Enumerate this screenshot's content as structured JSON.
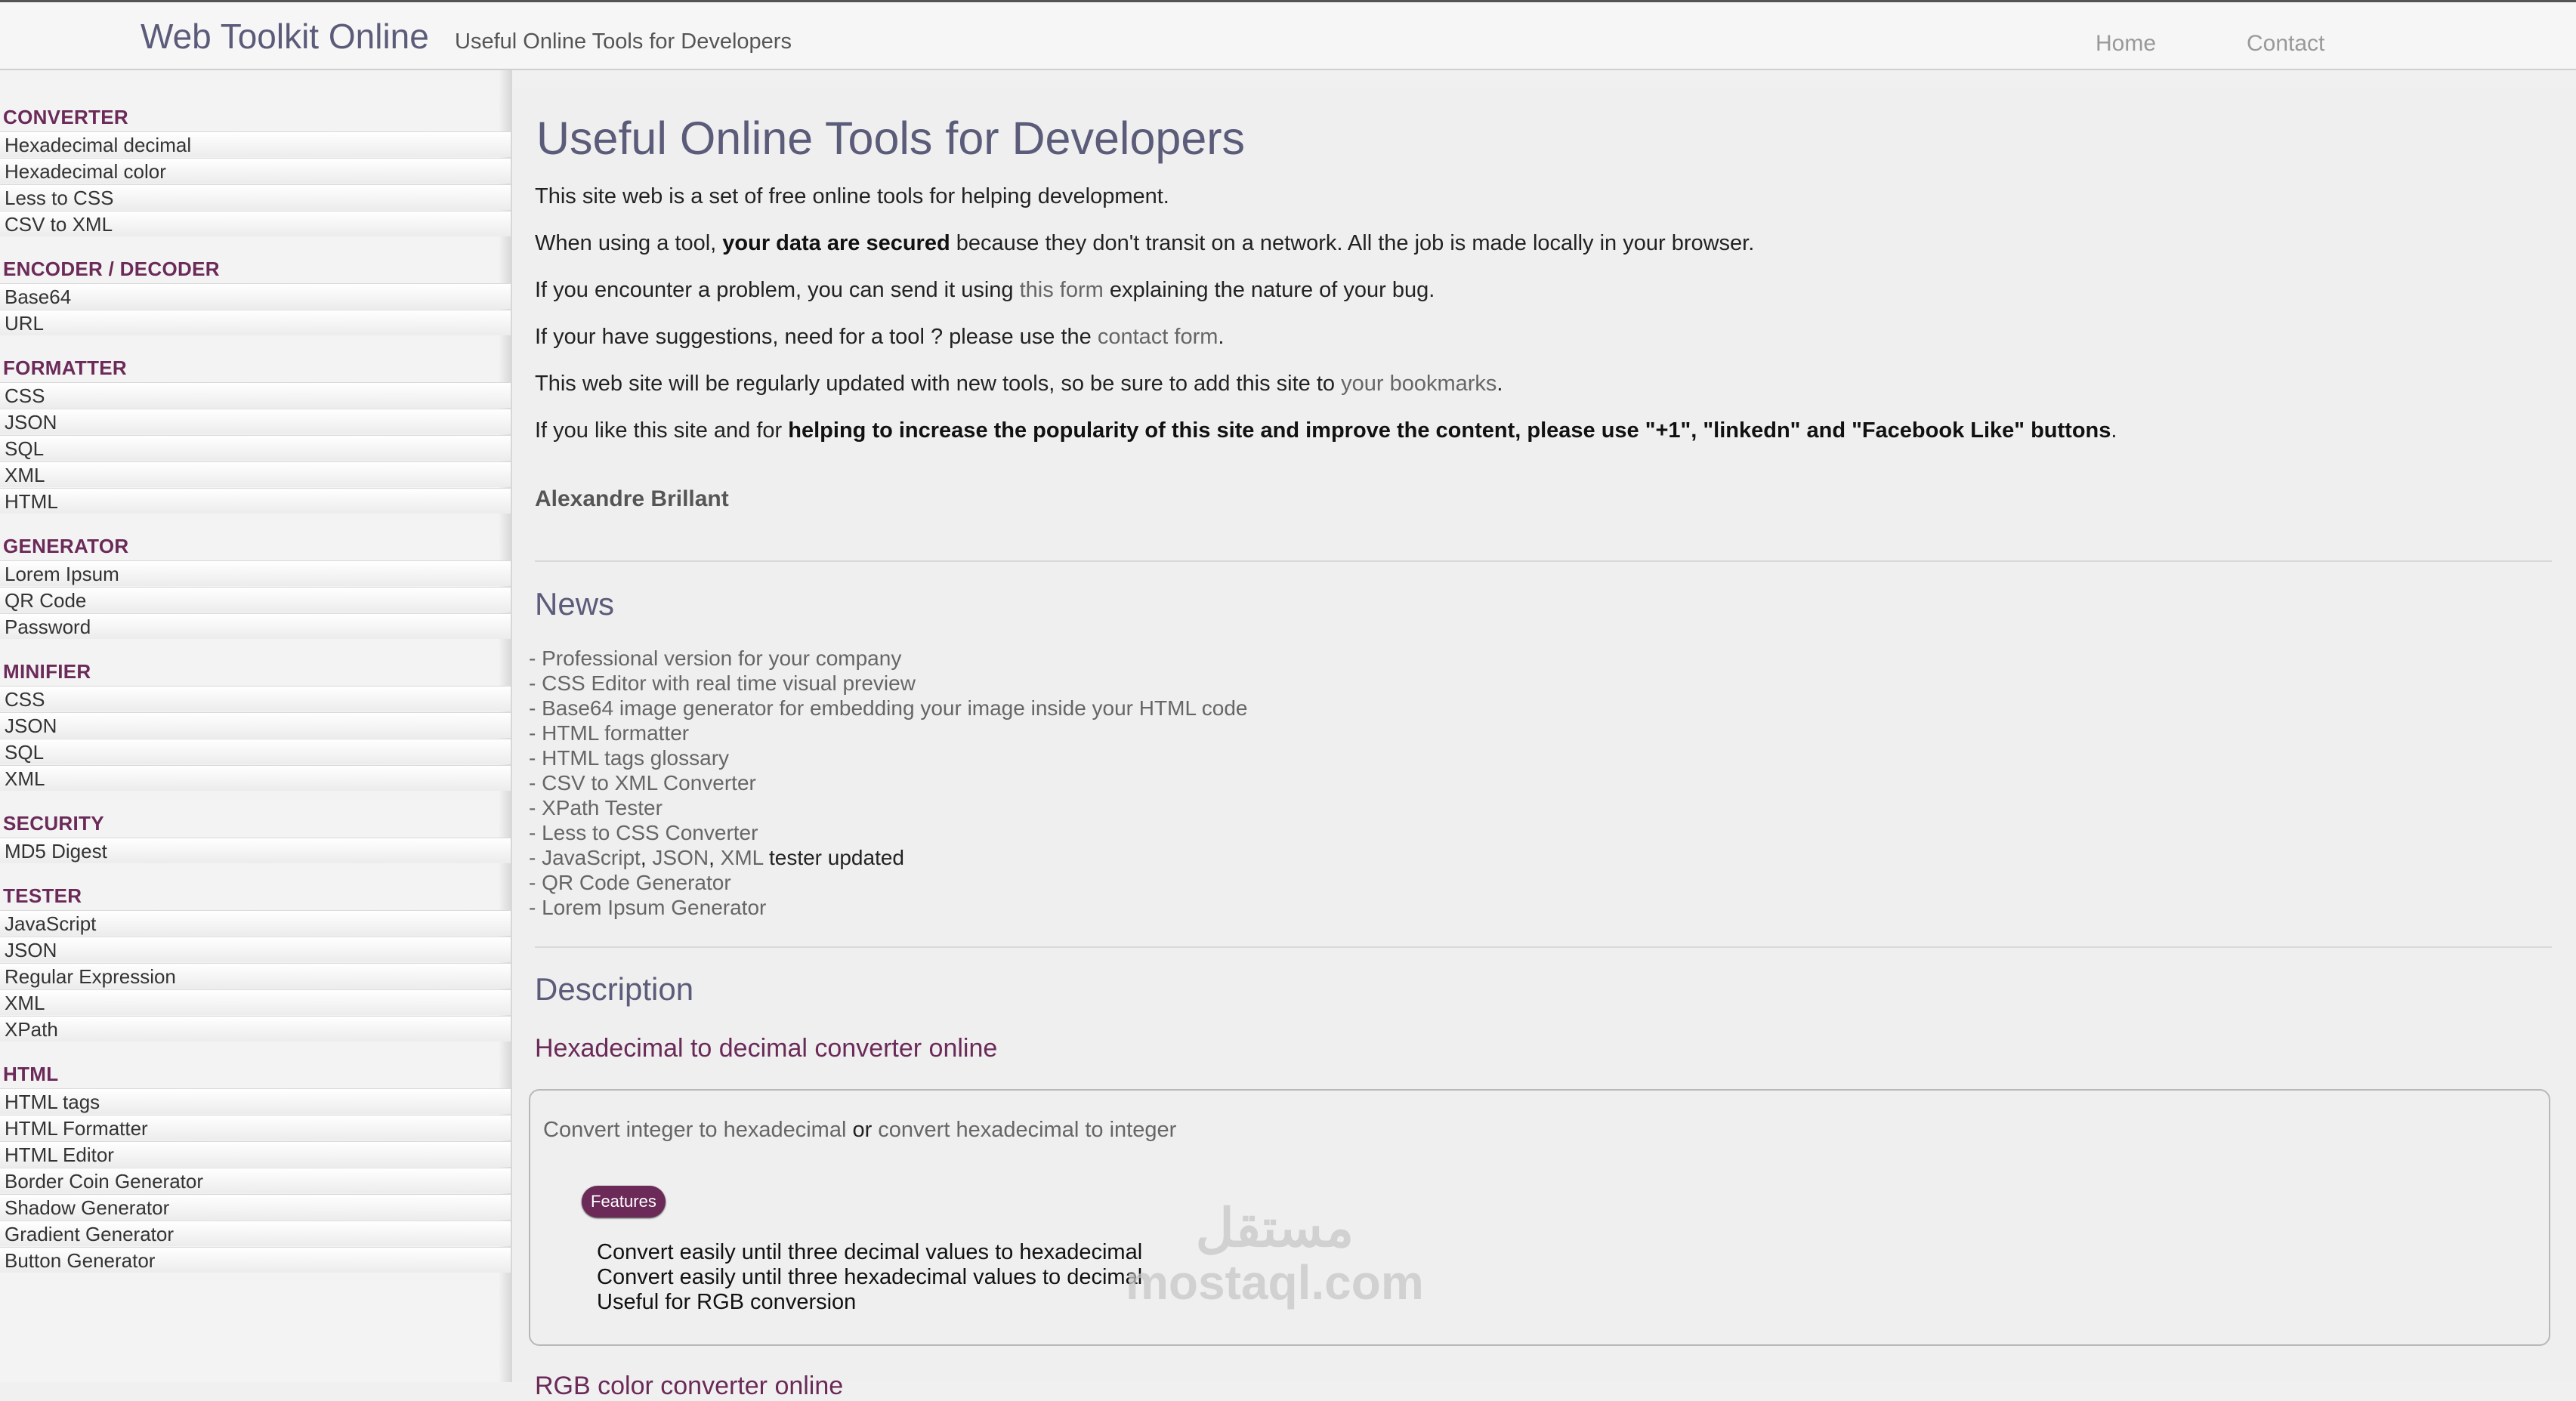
{
  "header": {
    "brand": "Web Toolkit Online",
    "tagline": "Useful Online Tools for Developers",
    "nav": {
      "home": "Home",
      "contact": "Contact"
    }
  },
  "sidebar": {
    "categories": [
      {
        "title": "CONVERTER",
        "items": [
          "Hexadecimal decimal",
          "Hexadecimal color",
          "Less to CSS",
          "CSV to XML"
        ]
      },
      {
        "title": "ENCODER / DECODER",
        "items": [
          "Base64",
          "URL"
        ]
      },
      {
        "title": "FORMATTER",
        "items": [
          "CSS",
          "JSON",
          "SQL",
          "XML",
          "HTML"
        ]
      },
      {
        "title": "GENERATOR",
        "items": [
          "Lorem Ipsum",
          "QR Code",
          "Password"
        ]
      },
      {
        "title": "MINIFIER",
        "items": [
          "CSS",
          "JSON",
          "SQL",
          "XML"
        ]
      },
      {
        "title": "SECURITY",
        "items": [
          "MD5 Digest"
        ]
      },
      {
        "title": "TESTER",
        "items": [
          "JavaScript",
          "JSON",
          "Regular Expression",
          "XML",
          "XPath"
        ]
      },
      {
        "title": "HTML",
        "items": [
          "HTML tags",
          "HTML Formatter",
          "HTML Editor",
          "Border Coin Generator",
          "Shadow Generator",
          "Gradient Generator",
          "Button Generator"
        ]
      }
    ]
  },
  "main": {
    "title": "Useful Online Tools for Developers",
    "intro": "This site web is a set of free online tools for helping development.",
    "secure": {
      "before": "When using a tool, ",
      "bold": "your data are secured",
      "after": " because they don't transit on a network. All the job is made locally in your browser."
    },
    "problem": {
      "before": "If you encounter a problem, you can send it using ",
      "link": "this form",
      "after": " explaining the nature of your bug."
    },
    "suggest": {
      "before": "If your have suggestions, need for a tool ? please use the ",
      "link": "contact form",
      "after": "."
    },
    "updated": {
      "before": "This web site will be regularly updated with new tools, so be sure to add this site to ",
      "link": "your bookmarks",
      "after": "."
    },
    "like": {
      "before": "If you like this site and for ",
      "bold": "helping to increase the popularity of this site and improve the content, please use \"+1\", \"linkedn\" and \"Facebook Like\" buttons",
      "after": "."
    },
    "author": "Alexandre Brillant",
    "news": {
      "heading": "News",
      "items": [
        "- Professional version for your company",
        "- CSS Editor with real time visual preview",
        "- Base64 image generator for embedding your image inside your HTML code",
        "- HTML formatter",
        "- HTML tags glossary",
        "- CSV to XML Converter",
        "- XPath Tester",
        "- Less to CSS Converter"
      ],
      "tester_updated": {
        "prefix": "- ",
        "links": [
          "JavaScript",
          "JSON",
          "XML"
        ],
        "sep": ", ",
        "suffix": " tester updated"
      },
      "items2": [
        "- QR Code Generator",
        "- Lorem Ipsum Generator"
      ]
    },
    "description": {
      "heading": "Description",
      "subheading": "Hexadecimal to decimal converter online",
      "convert": {
        "part1": "Convert integer to hexadecimal",
        "or": " or ",
        "part2": "convert hexadecimal to integer"
      },
      "badge": "Features",
      "features": [
        "Convert easily until three decimal values to hexadecimal",
        "Convert easily until three hexadecimal values to decimal",
        "Useful for RGB conversion"
      ],
      "next_heading_partial": "RGB color converter online"
    }
  },
  "watermark": {
    "arabic": "مستقل",
    "latin": "mostaql.com"
  }
}
